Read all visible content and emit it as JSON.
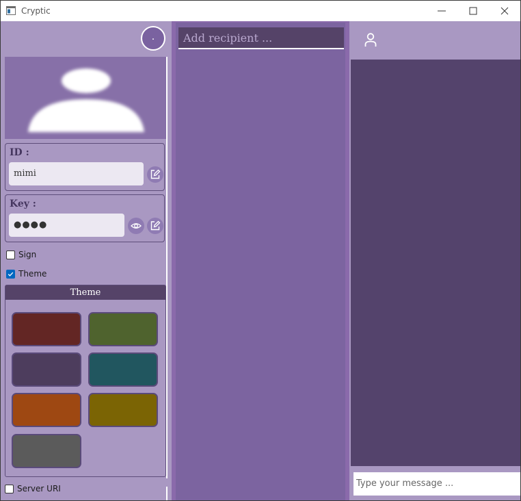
{
  "window": {
    "title": "Cryptic",
    "controls": [
      "minimize-icon",
      "maximize-icon",
      "close-icon"
    ]
  },
  "left_panel": {
    "avatar_label": ".",
    "id_field": {
      "label": "ID :",
      "value": "mimi"
    },
    "key_field": {
      "label": "Key :",
      "value": "●●●●"
    },
    "sign_checkbox": {
      "label": "Sign",
      "checked": false
    },
    "theme_checkbox": {
      "label": "Theme",
      "checked": true
    },
    "theme_section": {
      "title": "Theme",
      "swatches": [
        "#632624",
        "#4f632e",
        "#4d3d5d",
        "#21565f",
        "#9e4812",
        "#7b6404",
        "#5b5b5b"
      ]
    },
    "server_checkbox": {
      "label": "Server URI",
      "checked": false
    }
  },
  "middle_panel": {
    "recipient_placeholder": "Add recipient ..."
  },
  "right_panel": {
    "header_icon": "user-icon",
    "message_placeholder": "Type your message ..."
  },
  "colors": {
    "panel": "#a998c2",
    "accent_dark": "#554368",
    "accent_mid": "#7c64a0",
    "message_area": "#54436c"
  }
}
